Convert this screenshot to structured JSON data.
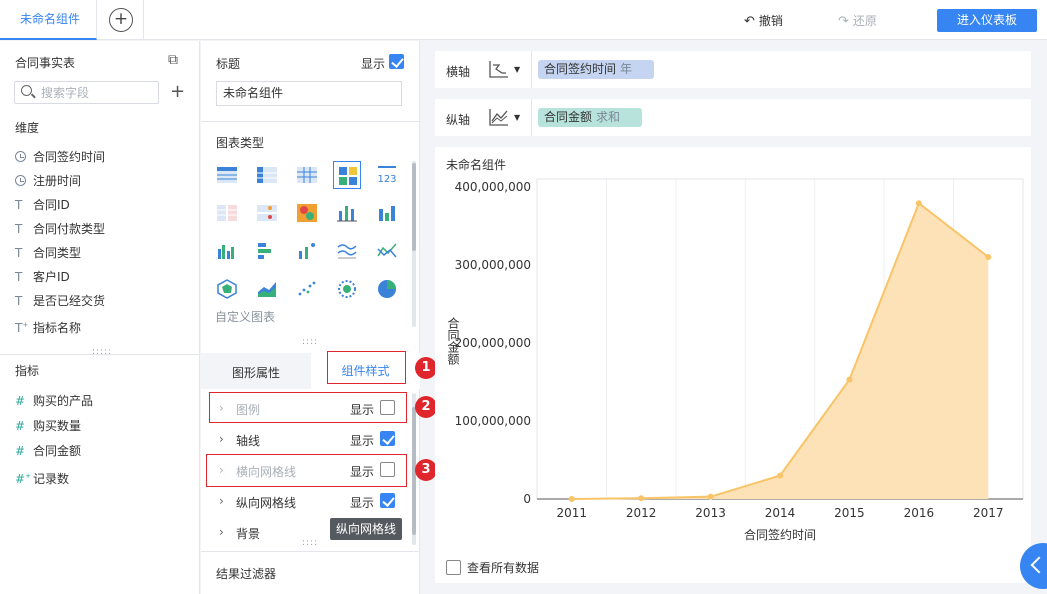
{
  "topbar": {
    "active_tab": "未命名组件",
    "undo_label": "撤销",
    "redo_label": "还原",
    "enter_dashboard_label": "进入仪表板"
  },
  "left_panel": {
    "title": "合同事实表",
    "search_placeholder": "搜索字段",
    "dimensions_title": "维度",
    "dimensions": [
      {
        "icon": "clock-icon",
        "label": "合同签约时间"
      },
      {
        "icon": "clock-icon",
        "label": "注册时间"
      },
      {
        "icon": "text-type-icon",
        "label": "合同ID"
      },
      {
        "icon": "text-type-icon",
        "label": "合同付款类型"
      },
      {
        "icon": "text-type-icon",
        "label": "合同类型"
      },
      {
        "icon": "text-type-icon",
        "label": "客户ID"
      },
      {
        "icon": "text-type-icon",
        "label": "是否已经交货"
      },
      {
        "icon": "text-formula-icon",
        "label": "指标名称"
      }
    ],
    "measures_title": "指标",
    "measures": [
      {
        "icon": "hash-icon",
        "label": "购买的产品"
      },
      {
        "icon": "hash-icon",
        "label": "购买数量"
      },
      {
        "icon": "hash-icon",
        "label": "合同金额"
      },
      {
        "icon": "hash-formula-icon",
        "label": "记录数"
      }
    ]
  },
  "config_panel": {
    "title_label": "标题",
    "show_label": "显示",
    "title_value": "未命名组件",
    "chart_type_label": "图表类型",
    "custom_chart_label": "自定义图表",
    "tab_graphic_attr": "图形属性",
    "tab_component_style": "组件样式",
    "style_rows": [
      {
        "label": "图例",
        "show": "显示",
        "checked": false
      },
      {
        "label": "轴线",
        "show": "显示",
        "checked": true
      },
      {
        "label": "横向网格线",
        "show": "显示",
        "checked": false
      },
      {
        "label": "纵向网格线",
        "show": "显示",
        "checked": true
      },
      {
        "label": "背景",
        "show": "",
        "checked": null
      }
    ],
    "tooltip": "纵向网格线",
    "filter_label": "结果过滤器",
    "annotations": [
      "1",
      "2",
      "3"
    ]
  },
  "axes": {
    "x_label": "横轴",
    "x_field": "合同签约时间",
    "x_field_sub": "年",
    "y_label": "纵轴",
    "y_field": "合同金额",
    "y_field_sub": "求和"
  },
  "chart_panel": {
    "title": "未命名组件",
    "view_all_label": "查看所有数据"
  },
  "colors": {
    "accent": "#3685f2",
    "area_fill": "#fde2b8",
    "area_line": "#f9c467",
    "annotation_red": "#e0262d"
  },
  "chart_data": {
    "type": "area",
    "title": "",
    "xlabel": "合同签约时间",
    "ylabel": "合同金额",
    "categories": [
      "2011",
      "2012",
      "2013",
      "2014",
      "2015",
      "2016",
      "2017"
    ],
    "values": [
      0,
      1000000,
      3000000,
      30000000,
      153000000,
      379000000,
      310000000
    ],
    "y_ticks": [
      "0",
      "100,000,000",
      "200,000,000",
      "300,000,000",
      "400,000,000"
    ],
    "ylim": [
      0,
      410000000
    ],
    "grid": "vertical lines only",
    "legend": "none"
  }
}
